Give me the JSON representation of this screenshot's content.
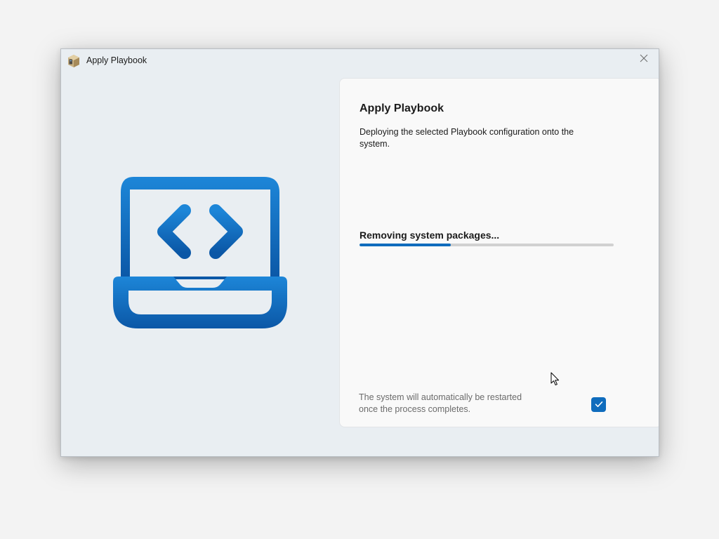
{
  "window": {
    "title": "Apply Playbook",
    "app_icon": "package-box-icon",
    "close_icon": "close-icon"
  },
  "illustration": {
    "icon": "laptop-code-icon",
    "color": "#1565b5"
  },
  "panel": {
    "title": "Apply Playbook",
    "description": "Deploying the selected Playbook configuration onto the system.",
    "status": "Removing system packages...",
    "progress": 0.36,
    "progress_color": "#0f6cbd",
    "footer_note": "The system will automatically be restarted once the process completes.",
    "restart_checkbox": {
      "checked": true,
      "icon": "checkmark-icon"
    }
  },
  "colors": {
    "accent": "#0f6cbd",
    "window_bg": "#e9eef2",
    "panel_bg": "#f9f9f9"
  }
}
